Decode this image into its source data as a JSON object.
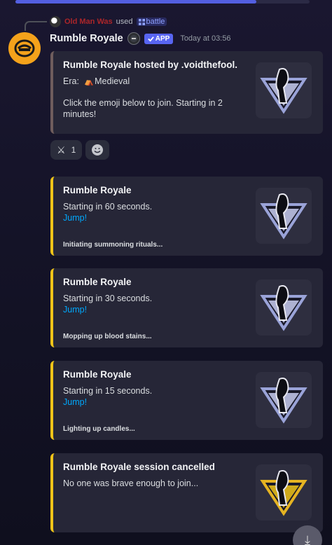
{
  "reply": {
    "username": "Old Man Was",
    "used_label": "used",
    "command": "battle"
  },
  "message": {
    "bot_name": "Rumble Royale",
    "app_badge": "APP",
    "timestamp": "Today at 03:56"
  },
  "embeds": [
    {
      "title": "Rumble Royale hosted by .voidthefool.",
      "era_label": "Era:",
      "era_value": "Medieval",
      "description": "Click the emoji below to join. Starting in 2 minutes!",
      "accent": "#6f5d5d"
    },
    {
      "title": "Rumble Royale",
      "description": "Starting in 60 seconds.",
      "link": "Jump!",
      "footer": "Initiating summoning rituals...",
      "accent": "#f0c419"
    },
    {
      "title": "Rumble Royale",
      "description": "Starting in 30 seconds.",
      "link": "Jump!",
      "footer": "Mopping up blood stains...",
      "accent": "#f0c419"
    },
    {
      "title": "Rumble Royale",
      "description": "Starting in 15 seconds.",
      "link": "Jump!",
      "footer": "Lighting up candles...",
      "accent": "#f0c419"
    },
    {
      "title": "Rumble Royale session cancelled",
      "description": "No one was brave enough to join...",
      "accent": "#f0c419"
    }
  ],
  "reactions": {
    "swords_count": "1",
    "swords_icon": "crossed-swords-icon",
    "add_icon": "add-reaction-icon"
  },
  "colors": {
    "accent_blue": "#5865f2",
    "link": "#00a8fc",
    "embed_bg": "#262637",
    "avatar_bg": "#f4a21b"
  }
}
